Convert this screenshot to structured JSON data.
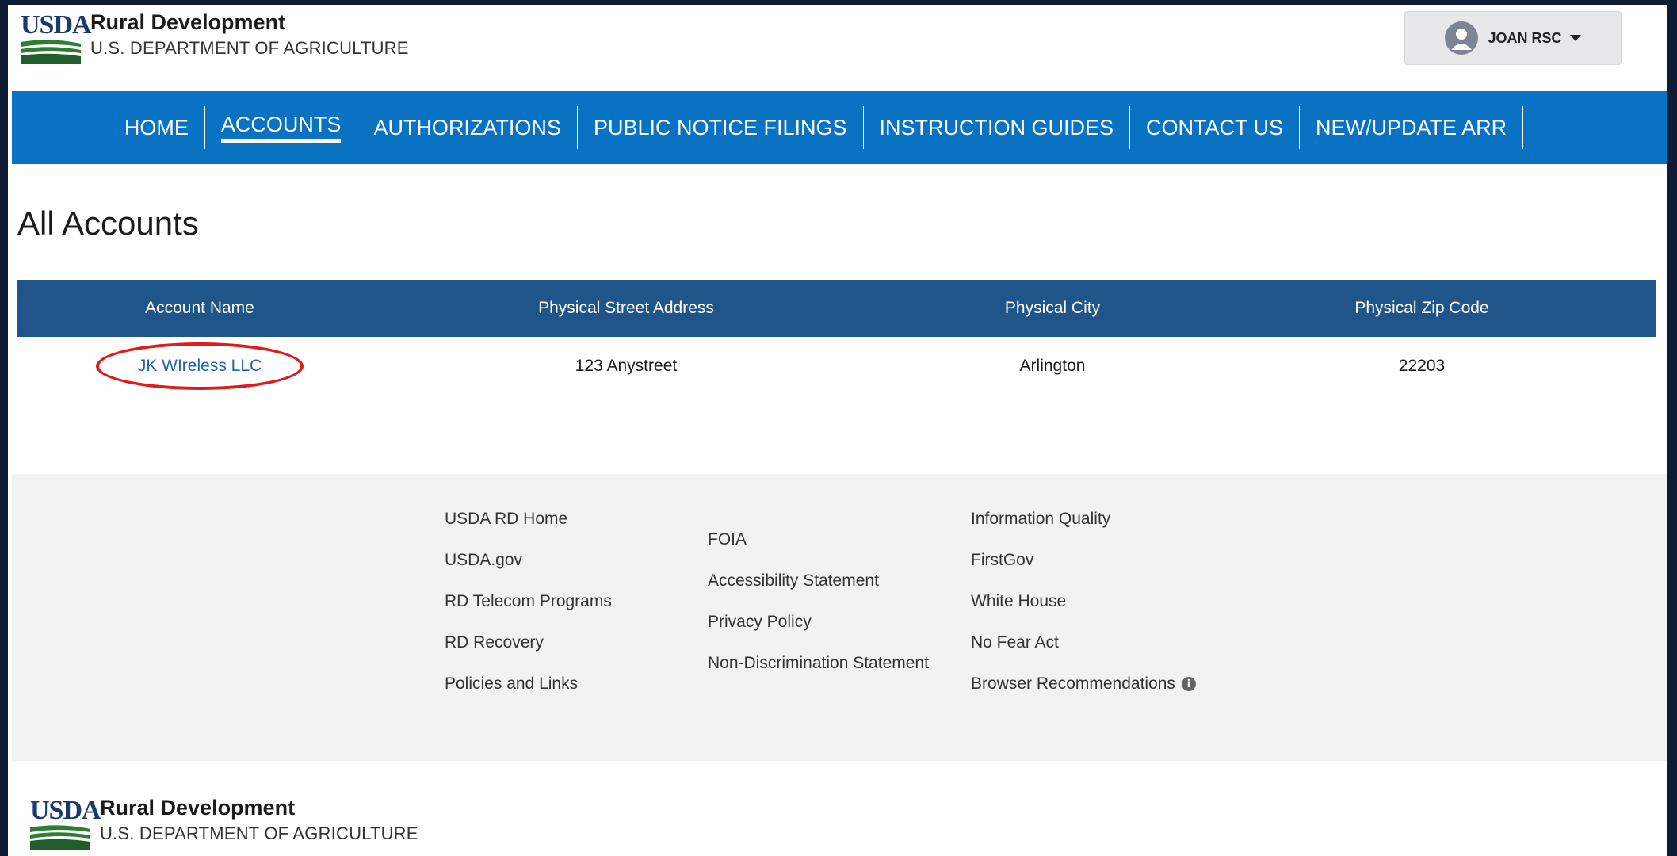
{
  "header": {
    "logo_usda": "USDA",
    "logo_title": "Rural Development",
    "logo_subtitle": "U.S. DEPARTMENT OF AGRICULTURE",
    "user_name": "JOAN RSC"
  },
  "nav": {
    "items": [
      {
        "label": "HOME"
      },
      {
        "label": "ACCOUNTS",
        "active": true
      },
      {
        "label": "AUTHORIZATIONS"
      },
      {
        "label": "PUBLIC NOTICE FILINGS"
      },
      {
        "label": "INSTRUCTION GUIDES"
      },
      {
        "label": "CONTACT US"
      },
      {
        "label": "NEW/UPDATE ARR"
      }
    ]
  },
  "page": {
    "title": "All Accounts"
  },
  "table": {
    "headers": [
      "Account Name",
      "Physical Street Address",
      "Physical City",
      "Physical Zip Code"
    ],
    "rows": [
      {
        "account_name": "JK WIreless LLC",
        "street": "123 Anystreet",
        "city": "Arlington",
        "zip": "22203"
      }
    ]
  },
  "footer": {
    "col1": [
      "USDA RD Home",
      "USDA.gov",
      "RD Telecom Programs",
      "RD Recovery",
      "Policies and Links"
    ],
    "col2": [
      "FOIA",
      "Accessibility Statement",
      "Privacy Policy",
      "Non-Discrimination Statement"
    ],
    "col3": [
      "Information Quality",
      "FirstGov",
      "White House",
      "No Fear Act",
      "Browser Recommendations"
    ],
    "info_glyph": "i"
  },
  "footer_logo": {
    "usda": "USDA",
    "title": "Rural Development",
    "subtitle": "U.S. DEPARTMENT OF AGRICULTURE"
  },
  "colors": {
    "nav_bg": "#0a72c2",
    "table_header_bg": "#20558a",
    "link": "#1f64b0",
    "highlight_oval": "#e01b1b",
    "footer_bg": "#f2f2f2"
  }
}
